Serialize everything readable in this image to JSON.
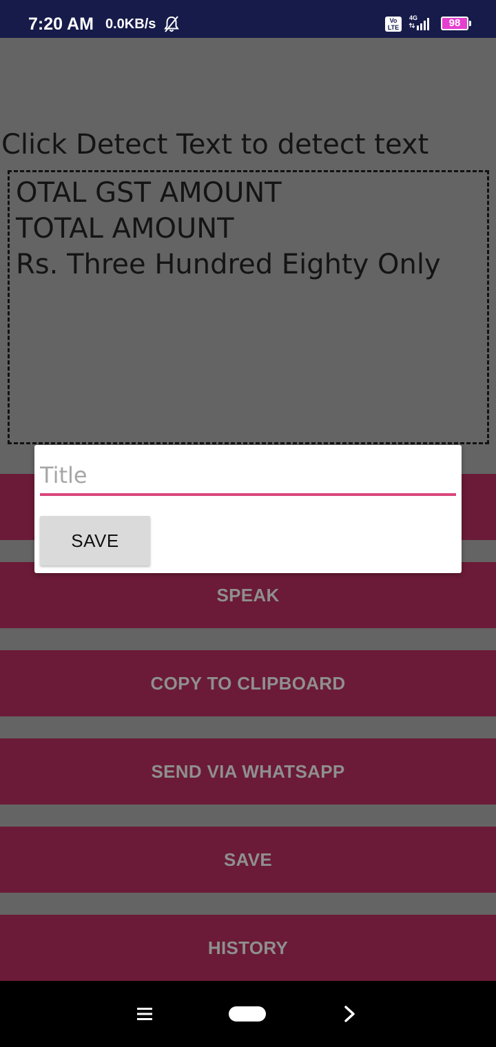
{
  "status_bar": {
    "time": "7:20 AM",
    "speed": "0.0KB/s",
    "bell_icon": "bell-muted-icon",
    "volte_top": "Vo",
    "volte_bottom": "LTE",
    "network": "4G",
    "battery": "98"
  },
  "main": {
    "instruction": "Click Detect Text to detect text",
    "detected_lines": [
      "OTAL GST AMOUNT",
      "TOTAL AMOUNT",
      "Rs. Three Hundred Eighty Only"
    ]
  },
  "buttons": {
    "speak": "SPEAK",
    "copy": "COPY TO CLIPBOARD",
    "whatsapp": "SEND VIA WHATSAPP",
    "save": "SAVE",
    "history": "HISTORY"
  },
  "dialog": {
    "title_placeholder": "Title",
    "title_value": "",
    "save_label": "SAVE"
  },
  "nav": {
    "menu_icon": "menu-icon",
    "home_icon": "home-pill-icon",
    "back_icon": "chevron-right-icon"
  },
  "colors": {
    "status_bar": "#161b4a",
    "scrim_background": "#646464",
    "button_background": "#6b1b37",
    "input_accent": "#d9467b",
    "battery": "#e53fd0"
  }
}
